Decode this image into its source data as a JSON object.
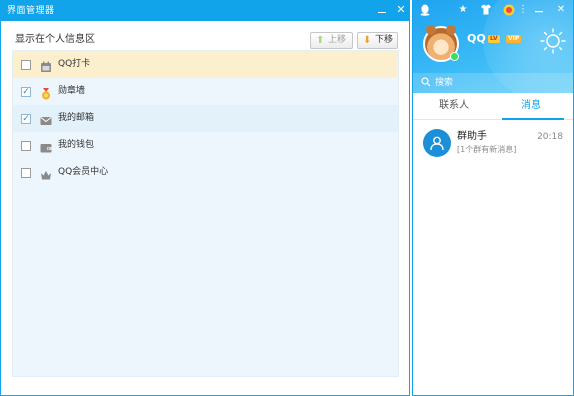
{
  "dialog": {
    "title": "界面管理器",
    "section_label": "显示在个人信息区",
    "move_up_label": "上移",
    "move_down_label": "下移",
    "items": [
      {
        "label": "QQ打卡",
        "checked": false,
        "icon": "calendar-icon"
      },
      {
        "label": "勋章墙",
        "checked": true,
        "icon": "medal-icon"
      },
      {
        "label": "我的邮箱",
        "checked": true,
        "icon": "mail-icon"
      },
      {
        "label": "我的钱包",
        "checked": false,
        "icon": "wallet-icon"
      },
      {
        "label": "QQ会员中心",
        "checked": false,
        "icon": "crown-icon"
      }
    ]
  },
  "panel": {
    "nickname": "QQ",
    "level_badge": "LV",
    "vip_badge": "VIP",
    "search_placeholder": "搜索",
    "tabs": [
      "联系人",
      "消息"
    ],
    "active_tab": "消息",
    "messages": [
      {
        "name": "群助手",
        "time": "20:18",
        "preview": "[1个群有新消息]"
      }
    ]
  },
  "colors": {
    "accent": "#12a4ea",
    "selected_row": "#fbefce",
    "list_bg": "#edf6fc"
  }
}
